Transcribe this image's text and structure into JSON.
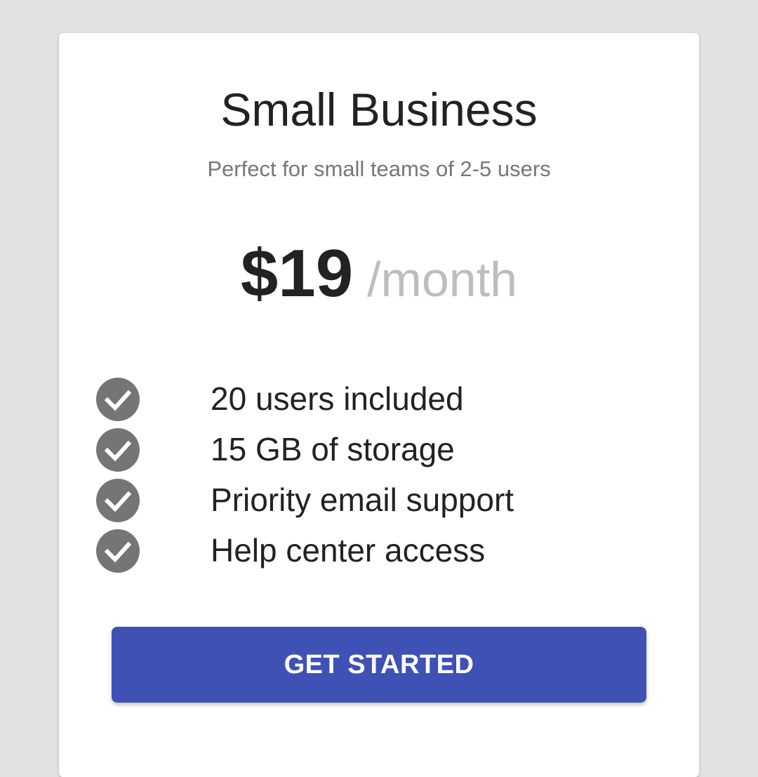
{
  "plan": {
    "name": "Small Business",
    "description": "Perfect for small teams of 2-5 users",
    "price": "$19",
    "period": "/month"
  },
  "features": [
    {
      "label": "20 users included",
      "icon": "check-circle-icon"
    },
    {
      "label": "15 GB of storage",
      "icon": "check-circle-icon"
    },
    {
      "label": "Priority email support",
      "icon": "check-circle-icon"
    },
    {
      "label": "Help center access",
      "icon": "check-circle-icon"
    }
  ],
  "cta": {
    "label": "GET STARTED"
  },
  "colors": {
    "page_background": "#e2e2e2",
    "card_background": "#ffffff",
    "accent": "#3f51b5",
    "check_icon": "#757575",
    "muted_text": "#777777",
    "period_text": "#bdbdbd"
  }
}
